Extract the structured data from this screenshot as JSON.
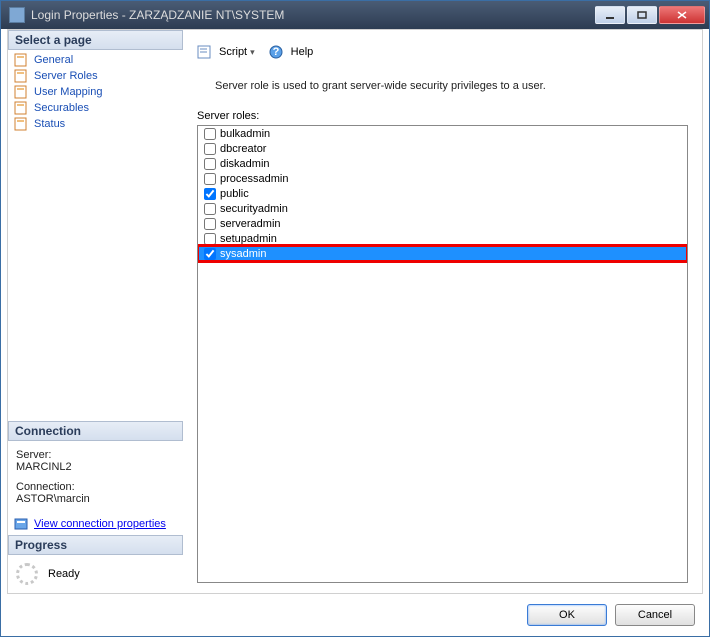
{
  "window": {
    "title": "Login Properties - ZARZĄDZANIE NT\\SYSTEM"
  },
  "sidebar": {
    "select_header": "Select a page",
    "pages": [
      {
        "label": "General"
      },
      {
        "label": "Server Roles"
      },
      {
        "label": "User Mapping"
      },
      {
        "label": "Securables"
      },
      {
        "label": "Status"
      }
    ],
    "connection_header": "Connection",
    "connection": {
      "server_label": "Server:",
      "server_value": "MARCINL2",
      "connection_label": "Connection:",
      "connection_value": "ASTOR\\marcin",
      "link_text": "View connection properties"
    },
    "progress_header": "Progress",
    "progress_status": "Ready"
  },
  "toolbar": {
    "script_label": "Script",
    "help_label": "Help"
  },
  "main": {
    "description": "Server role is used to grant server-wide security privileges to a user.",
    "roles_label": "Server roles:",
    "roles": [
      {
        "name": "bulkadmin",
        "checked": false,
        "selected": false,
        "highlighted": false
      },
      {
        "name": "dbcreator",
        "checked": false,
        "selected": false,
        "highlighted": false
      },
      {
        "name": "diskadmin",
        "checked": false,
        "selected": false,
        "highlighted": false
      },
      {
        "name": "processadmin",
        "checked": false,
        "selected": false,
        "highlighted": false
      },
      {
        "name": "public",
        "checked": true,
        "selected": false,
        "highlighted": false
      },
      {
        "name": "securityadmin",
        "checked": false,
        "selected": false,
        "highlighted": false
      },
      {
        "name": "serveradmin",
        "checked": false,
        "selected": false,
        "highlighted": false
      },
      {
        "name": "setupadmin",
        "checked": false,
        "selected": false,
        "highlighted": false
      },
      {
        "name": "sysadmin",
        "checked": true,
        "selected": true,
        "highlighted": true
      }
    ]
  },
  "footer": {
    "ok_label": "OK",
    "cancel_label": "Cancel"
  },
  "icons": {
    "page": "page-icon",
    "script": "script-icon",
    "help": "help-icon",
    "link": "link-icon"
  }
}
